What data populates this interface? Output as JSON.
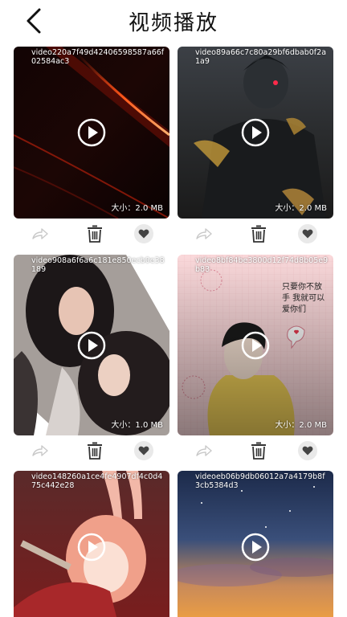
{
  "header": {
    "title": "视频播放",
    "back_icon": "chevron-left-icon"
  },
  "videos": [
    {
      "name": "video220a7f49d42406598587a66f02584ac3",
      "size": "大小：2.0 MB"
    },
    {
      "name": "video89a66c7c80a29bf6dbab0f2a1a9",
      "size": "大小：2.0 MB"
    },
    {
      "name": "video908a6f6a6c181e850ecb0e38189",
      "size": "大小：1.0 MB"
    },
    {
      "name": "video8bf84be3800d12f74d8b05e9b83",
      "size": "大小：2.0 MB"
    },
    {
      "name": "video148260a1ce4fe4907df4c0d475c442e28",
      "size": ""
    },
    {
      "name": "videoeb06b9db06012a7a4179b8f3cb5384d3",
      "size": ""
    }
  ],
  "card_art_text": {
    "love_caption": "只要你不放手 我就可以 爱你们"
  },
  "action_icons": [
    "share-arrow-icon",
    "trash-icon",
    "heart-icon"
  ],
  "colors": {
    "action_icon": "#bdbdbd",
    "delete_icon": "#333333",
    "like_bg": "#e9e9e9"
  }
}
